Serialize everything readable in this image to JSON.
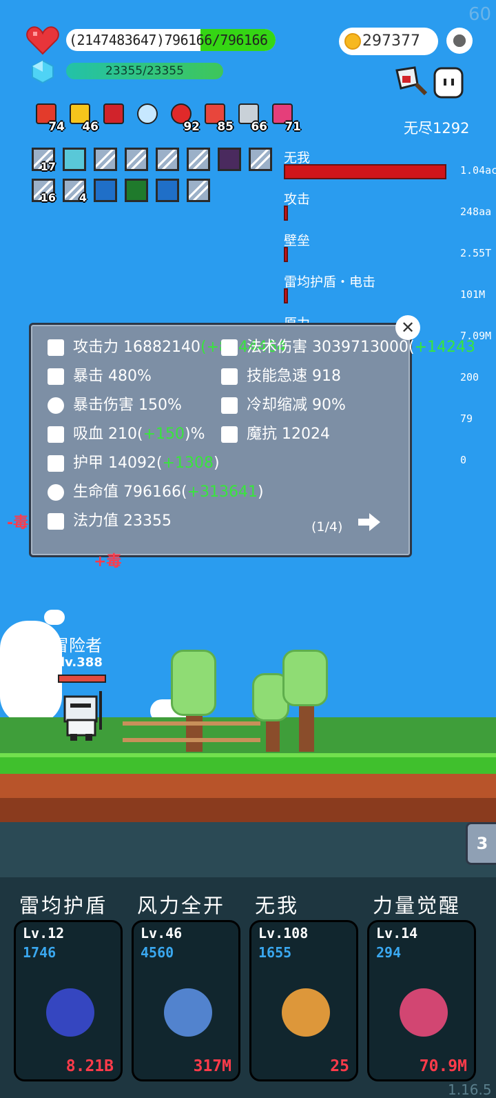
{
  "fps": "60",
  "hp": {
    "text": "(2147483647)796166/796166",
    "fraction": 1.0
  },
  "mp": {
    "text": "23355/23355",
    "fraction": 1.0
  },
  "coins": "297377",
  "endless_stage": "无尽1292",
  "items": [
    {
      "icon": "sock-icon",
      "count": "74",
      "color": "#e33b2b"
    },
    {
      "icon": "crown-icon",
      "count": "46",
      "color": "#f6c51c"
    },
    {
      "icon": "magnet-icon",
      "count": "",
      "color": "#d1232b"
    },
    {
      "icon": "magnifier-icon",
      "count": "",
      "color": "#c7e8ff"
    },
    {
      "icon": "apple-icon",
      "count": "92",
      "color": "#e02a2a"
    },
    {
      "icon": "watermelon-icon",
      "count": "85",
      "color": "#e8463c"
    },
    {
      "icon": "sword-icon",
      "count": "66",
      "color": "#c9d1d8"
    },
    {
      "icon": "jam-jar-icon",
      "count": "71",
      "color": "#e53e7a"
    }
  ],
  "skill_slots_row1": [
    {
      "icon": "sword-slot-icon",
      "count": "17"
    },
    {
      "icon": "lightbulb-slot-icon",
      "count": ""
    },
    {
      "icon": "sword-slot-icon",
      "count": ""
    },
    {
      "icon": "sword-slot-icon",
      "count": ""
    },
    {
      "icon": "sword-slot-icon",
      "count": ""
    },
    {
      "icon": "shield-slot-icon",
      "count": ""
    },
    {
      "icon": "demon-slot-icon",
      "count": ""
    },
    {
      "icon": "shield-slot-icon",
      "count": ""
    }
  ],
  "skill_slots_row2": [
    {
      "icon": "sword-slot-icon",
      "count": "16"
    },
    {
      "icon": "sword-slot-icon",
      "count": "4"
    },
    {
      "icon": "vortex-slot-icon",
      "count": ""
    },
    {
      "icon": "rune-slot-icon",
      "count": ""
    },
    {
      "icon": "star-burst-slot-icon",
      "count": ""
    },
    {
      "icon": "sword-slot-icon",
      "count": ""
    }
  ],
  "dps_list": [
    {
      "label": "无我",
      "value": "1.04ac",
      "fraction": 1.0
    },
    {
      "label": "攻击",
      "value": "248aa",
      "fraction": 0.02
    },
    {
      "label": "壁垒",
      "value": "2.55T",
      "fraction": 0.02
    },
    {
      "label": "雷均护盾・电击",
      "value": "101M",
      "fraction": 0.02
    },
    {
      "label": "原力",
      "value": "7.09M",
      "fraction": 0.02
    },
    {
      "label": "",
      "value": "200",
      "fraction": 0
    },
    {
      "label": "",
      "value": "79",
      "fraction": 0
    },
    {
      "label": "",
      "value": "0",
      "fraction": 0
    }
  ],
  "stats_panel": {
    "left": [
      {
        "icon": "axe-icon",
        "label": "攻击力",
        "value": "16882140",
        "bonus": "(+8544464"
      },
      {
        "icon": "crossed-swords-icon",
        "label": "暴击",
        "value": "480%",
        "bonus": ""
      },
      {
        "icon": "crit-ring-icon",
        "label": "暴击伤害",
        "value": "150%",
        "bonus": ""
      },
      {
        "icon": "vampire-skull-icon",
        "label": "吸血",
        "value": "210(",
        "bonus": "+150",
        "suffix": ")%"
      },
      {
        "icon": "shield-icon",
        "label": "护甲",
        "value": "14092(",
        "bonus": "+1308",
        "suffix": ")"
      },
      {
        "icon": "heart-icon",
        "label": "生命值",
        "value": "796166(",
        "bonus": "+313641",
        "suffix": ")"
      },
      {
        "icon": "hexagon-gem-icon",
        "label": "法力值",
        "value": "23355",
        "bonus": ""
      }
    ],
    "right": [
      {
        "icon": "sun-icon",
        "label": "法术伤害",
        "value": "3039713000(",
        "bonus": "+14243"
      },
      {
        "icon": "lightning-icon",
        "label": "技能急速",
        "value": "918",
        "bonus": ""
      },
      {
        "icon": "hourglass-icon",
        "label": "冷却缩减",
        "value": "90%",
        "bonus": ""
      },
      {
        "icon": "magic-shield-icon",
        "label": "魔抗",
        "value": "12024",
        "bonus": ""
      }
    ],
    "page": "(1/4)"
  },
  "floating_damage": [
    "-毒",
    "+毒"
  ],
  "hero": {
    "name": "冒险者",
    "level": "lv.388"
  },
  "side_tab": "3",
  "skills": [
    {
      "title": "雷均护盾",
      "level": "Lv.12",
      "cost": "1746",
      "damage": "8.21B",
      "icon": "thunder-shield-icon"
    },
    {
      "title": "风力全开",
      "level": "Lv.46",
      "cost": "4560",
      "damage": "317M",
      "icon": "feather-icon"
    },
    {
      "title": "无我",
      "level": "Lv.108",
      "cost": "1655",
      "damage": "25",
      "icon": "eye-hand-icon"
    },
    {
      "title": "力量觉醒",
      "level": "Lv.14",
      "cost": "294",
      "damage": "70.9M",
      "icon": "potion-tube-icon"
    }
  ],
  "version": "1.16.5"
}
